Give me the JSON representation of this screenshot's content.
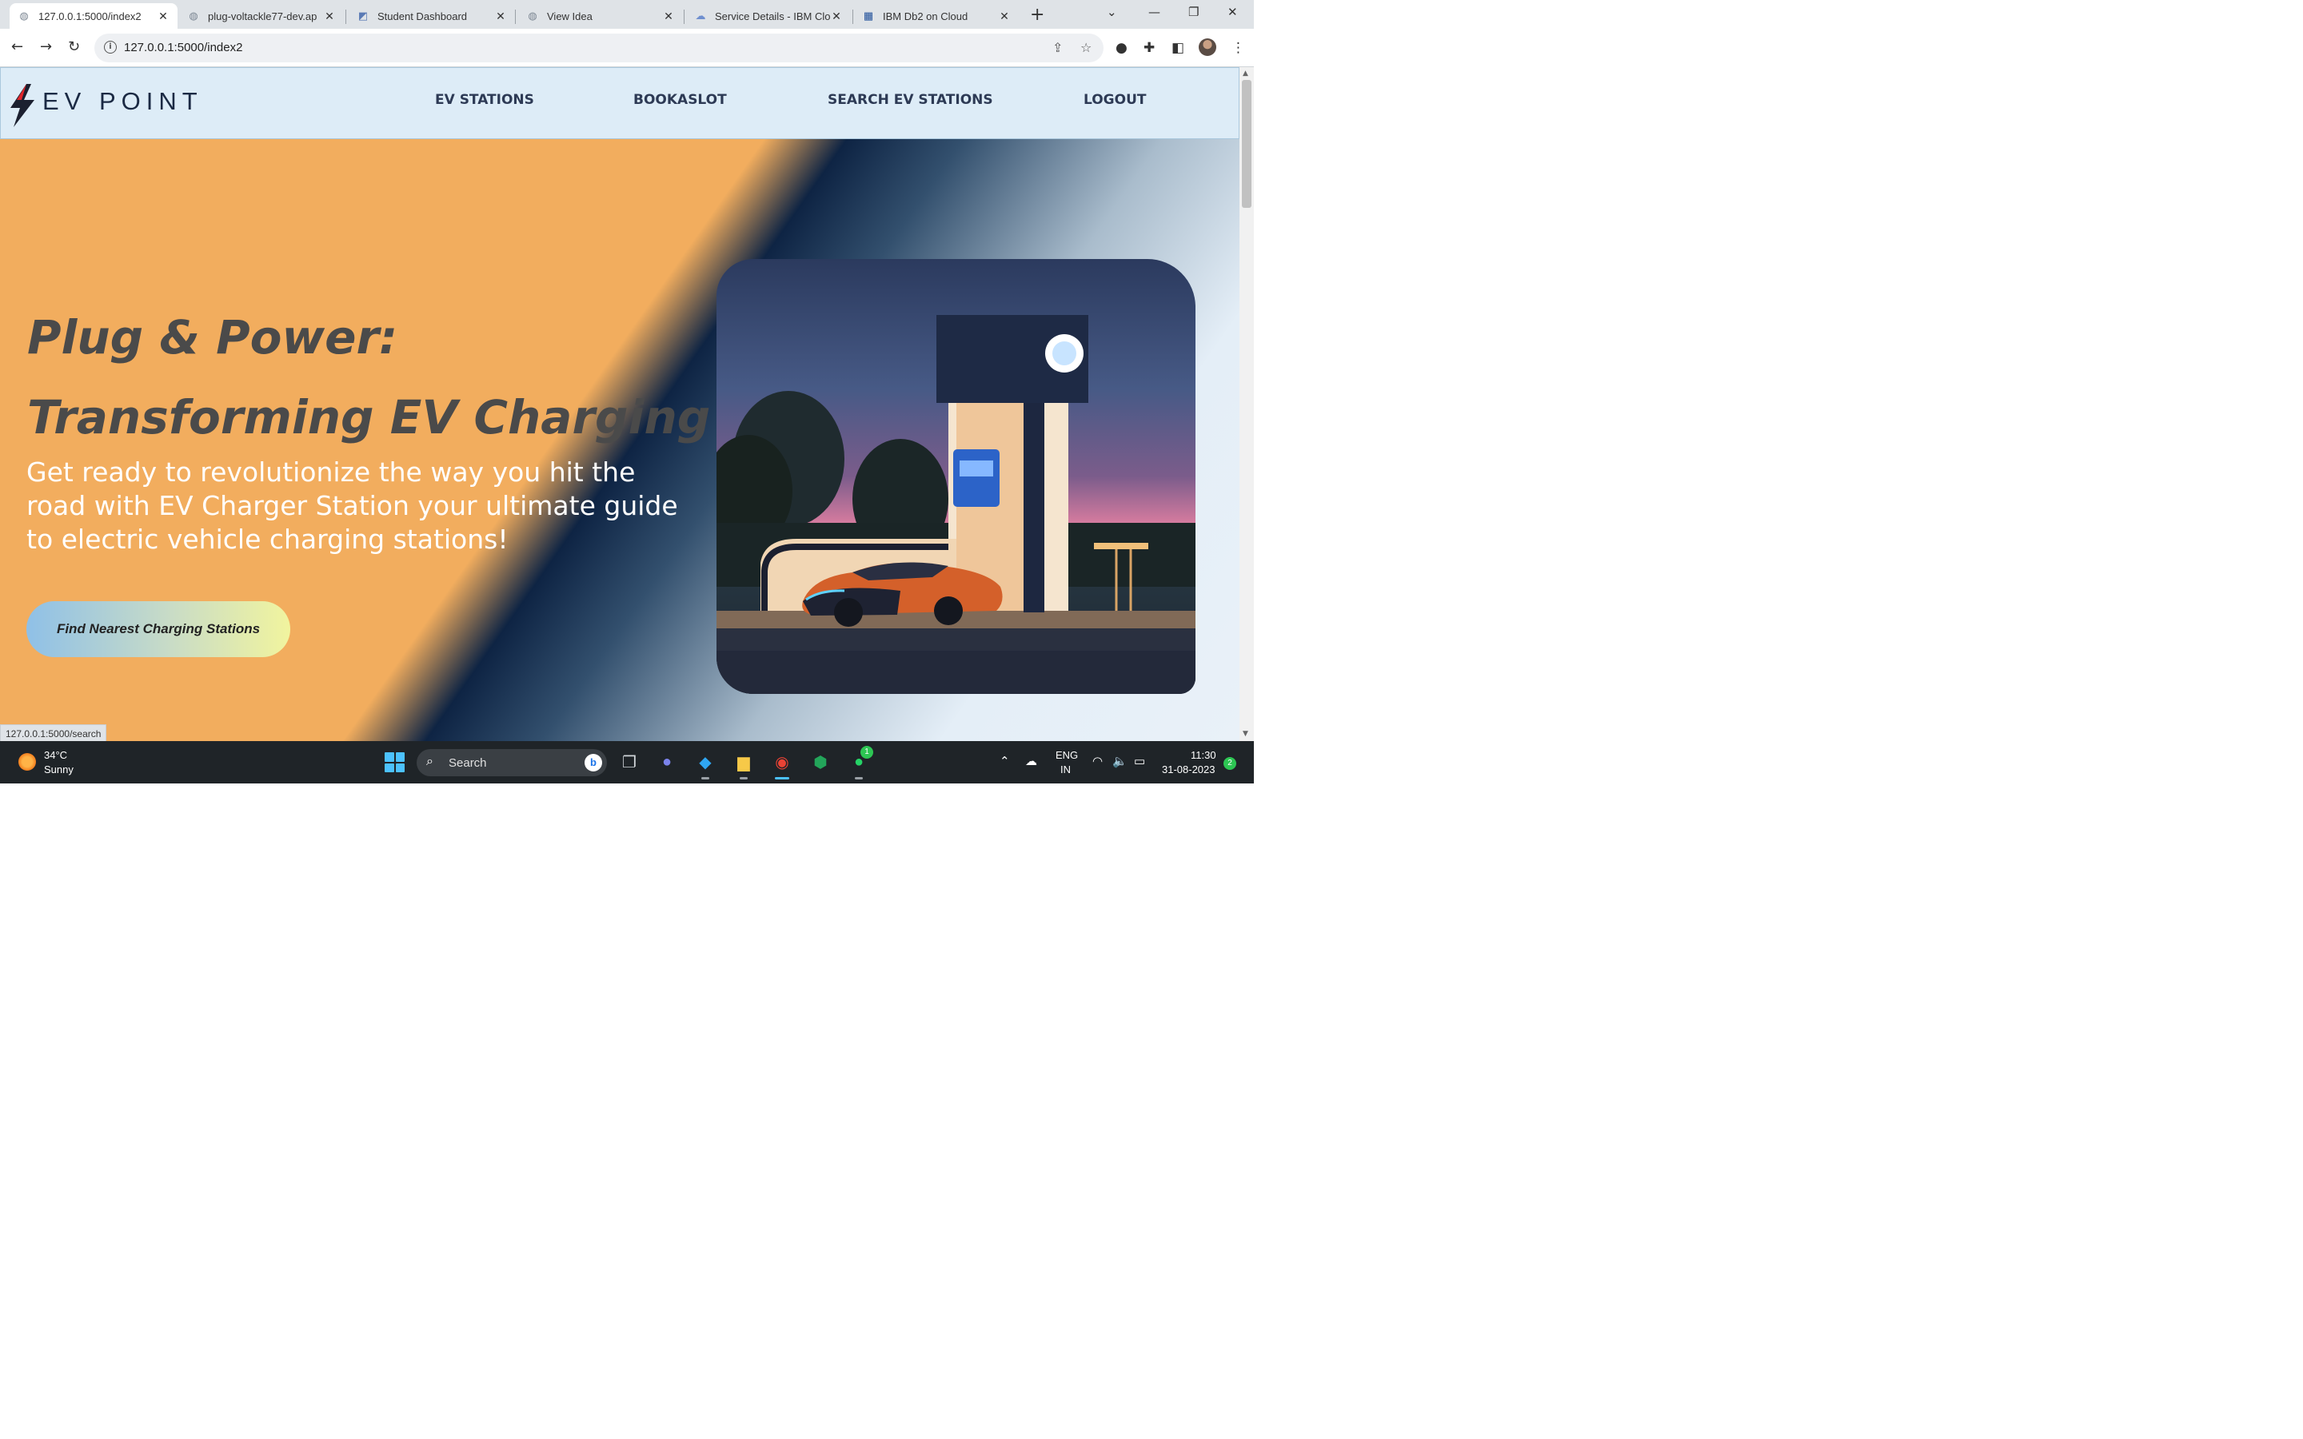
{
  "browser": {
    "tabs": [
      {
        "title": "127.0.0.1:5000/index2",
        "favicon": "globe-icon",
        "active": true
      },
      {
        "title": "plug-voltackle77-dev.ap",
        "favicon": "globe-icon",
        "active": false
      },
      {
        "title": "Student Dashboard",
        "favicon": "dashboard-icon",
        "active": false
      },
      {
        "title": "View Idea",
        "favicon": "globe-icon",
        "active": false
      },
      {
        "title": "Service Details - IBM Clo",
        "favicon": "cloud-icon",
        "active": false
      },
      {
        "title": "IBM Db2 on Cloud",
        "favicon": "db2-icon",
        "active": false
      }
    ],
    "url": "127.0.0.1:5000/index2",
    "status_url": "127.0.0.1:5000/search"
  },
  "site": {
    "logo_text": "EV POINT",
    "nav": [
      {
        "label": "EV STATIONS"
      },
      {
        "label": "BOOKASLOT"
      },
      {
        "label": "SEARCH EV STATIONS"
      },
      {
        "label": "LOGOUT"
      }
    ],
    "hero": {
      "headline_1": "Plug & Power:",
      "headline_2": "Transforming EV Charging",
      "lede": "Get ready to revolutionize the way you hit the road with EV Charger Station your ultimate guide to electric vehicle charging stations!",
      "cta_label": "Find Nearest Charging Stations",
      "image_subject": "ev-charging-station-with-car-illustration"
    },
    "colors": {
      "nav_bg": "#ddecf7",
      "hero_orange": "#f2ad5e",
      "headline": "#4a4a4a",
      "text_white": "#ffffff"
    }
  },
  "taskbar": {
    "weather_temp": "34°C",
    "weather_desc": "Sunny",
    "search_label": "Search",
    "bing_letter": "b",
    "whatsapp_badge": "1",
    "lang_1": "ENG",
    "lang_2": "IN",
    "time": "11:30",
    "date": "31-08-2023",
    "notifications": "2"
  }
}
